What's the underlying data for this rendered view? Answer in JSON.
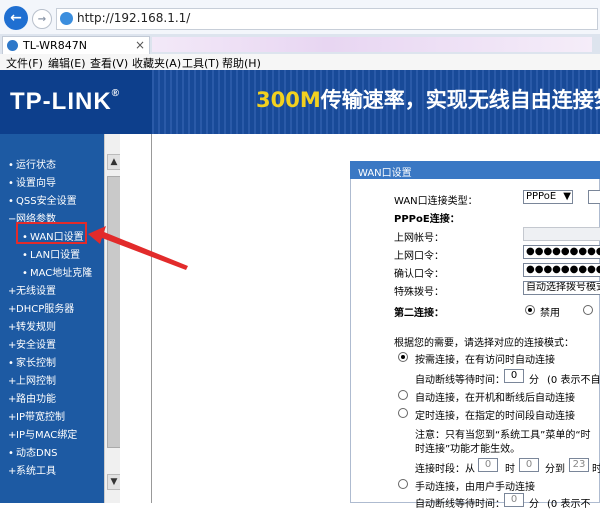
{
  "browser": {
    "url": "http://192.168.1.1/",
    "tab_title": "TL-WR847N",
    "tab_close": "×",
    "menu": [
      "文件(F)",
      "编辑(E)",
      "查看(V)",
      "收藏夹(A)",
      "工具(T)",
      "帮助(H)"
    ]
  },
  "header": {
    "logo": "TP-LINK",
    "logo_mark": "®",
    "banner_highlight": "300M",
    "banner_text": "传输速率，实现无线自由连接梦"
  },
  "sidebar": {
    "items": [
      {
        "label": "运行状态",
        "bullet": "•"
      },
      {
        "label": "设置向导",
        "bullet": "•"
      },
      {
        "label": "QSS安全设置",
        "bullet": "•"
      },
      {
        "label": "网络参数",
        "bullet": "−"
      },
      {
        "label": "WAN口设置",
        "bullet": "•"
      },
      {
        "label": "LAN口设置",
        "bullet": "•"
      },
      {
        "label": "MAC地址克隆",
        "bullet": "•"
      },
      {
        "label": "无线设置",
        "bullet": "+"
      },
      {
        "label": "DHCP服务器",
        "bullet": "+"
      },
      {
        "label": "转发规则",
        "bullet": "+"
      },
      {
        "label": "安全设置",
        "bullet": "+"
      },
      {
        "label": "家长控制",
        "bullet": "•"
      },
      {
        "label": "上网控制",
        "bullet": "+"
      },
      {
        "label": "路由功能",
        "bullet": "+"
      },
      {
        "label": "IP带宽控制",
        "bullet": "+"
      },
      {
        "label": "IP与MAC绑定",
        "bullet": "+"
      },
      {
        "label": "动态DNS",
        "bullet": "•"
      },
      {
        "label": "系统工具",
        "bullet": "+"
      }
    ]
  },
  "panel": {
    "title": "WAN口设置",
    "conn_type_label": "WAN口连接类型：",
    "conn_type_value": "PPPoE",
    "pppoe_label": "PPPoE连接：",
    "account_label": "上网帐号：",
    "password_label": "上网口令：",
    "confirm_label": "确认口令：",
    "password_mask": "●●●●●●●●●●",
    "dial_label": "特殊拨号：",
    "dial_value": "自动选择拨号模式",
    "second_label": "第二连接：",
    "second_opt1": "禁用",
    "mode_intro": "根据您的需要，请选择对应的连接模式：",
    "mode_on_demand": "按需连接，在有访问时自动连接",
    "auto_disconnect_label": "自动断线等待时间：",
    "wait_value": "0",
    "minute": "分",
    "zero_hint": "(0 表示不自",
    "mode_auto": "自动连接，在开机和断线后自动连接",
    "mode_timed": "定时连接，在指定的时间段自动连接",
    "note_line1": "注意：只有当您到“系统工具”菜单的“时",
    "note_line2": "时连接”功能才能生效。",
    "period_label": "连接时段：从",
    "period_from_h": "0",
    "period_h": "时",
    "period_from_m": "0",
    "period_m_to": "分到",
    "period_to_h": "23",
    "period_h2": "时",
    "mode_manual": "手动连接，由用户手动连接",
    "auto_disconnect_label2": "自动断线等待时间：",
    "zero_hint2": "(0 表示不"
  }
}
